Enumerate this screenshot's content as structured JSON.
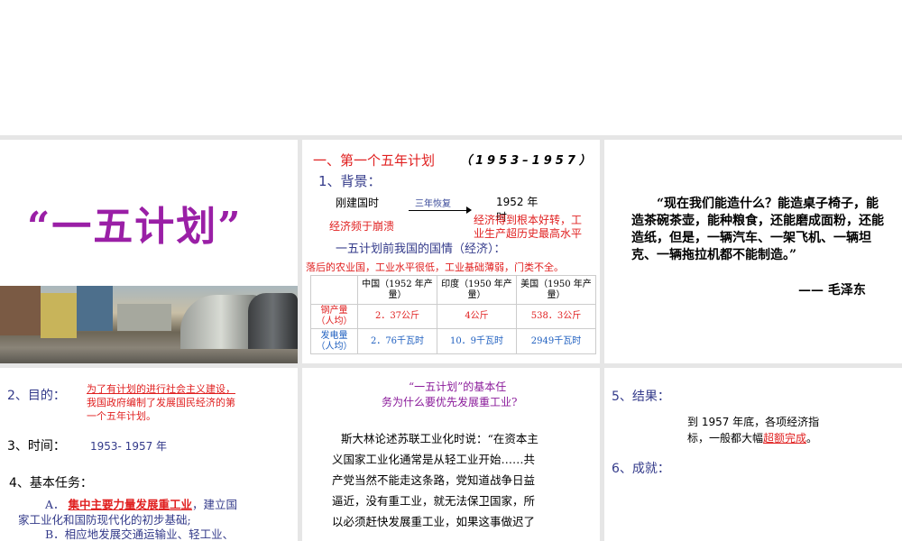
{
  "slide1": {
    "title": "“一五计划”"
  },
  "slide2": {
    "heading": "一、第一个五年计划",
    "years": "（1953–1957）",
    "bg": "1、背景：",
    "start": "刚建国时",
    "arrow": "三年恢复",
    "end": "1952 年时",
    "start_state": "经济频于崩溃",
    "end_state_1": "经济得到根本好转，工",
    "end_state_2": "业生产超历史最高水平",
    "situation": "一五计划前我国的国情（经济）：",
    "summary": "落后的农业国，工业水平很低，工业基础薄弱，门类不全。",
    "table": {
      "headers": [
        "",
        "中国（1952 年产量）",
        "印度（1950 年产量）",
        "美国（1950 年产量）"
      ],
      "rows": [
        [
          "钢产量（人均）",
          "2．37公斤",
          "4公斤",
          "538．3公斤"
        ],
        [
          "发电量（人均）",
          "2．76千瓦时",
          "10．9千瓦时",
          "2949千瓦时"
        ]
      ]
    }
  },
  "slide3": {
    "quote": "“现在我们能造什么？能造桌子椅子，能造茶碗茶壶，能种粮食，还能磨成面粉，还能造纸，但是，一辆汽车、一架飞机、一辆坦克、一辆拖拉机都不能制造。”",
    "author": "—— 毛泽东"
  },
  "slide4": {
    "purpose_label": "2、目的：",
    "purpose_1": "为了有计划的进行社会主义建设，",
    "purpose_2": "我国政府编制了发展国民经济的第",
    "purpose_3": "一个五年计划。",
    "time_label": "3、时间：",
    "time_value": "1953- 1957 年",
    "task_label": "4、基本任务：",
    "task_a_prefix": "A．",
    "task_a_key": "集中主要力量发展重工业",
    "task_a_rest": "，建立国",
    "task_a_2": "家工业化和国防现代化的初步基础;",
    "task_b": "B．相应地发展交通运输业、轻工业、"
  },
  "slide5": {
    "question_1": "“一五计划”的基本任",
    "question_2": "务为什么要优先发展重工业?",
    "lines": [
      "斯大林论述苏联工业化时说：“在资本主",
      "义国家工业化通常是从轻工业开始……共",
      "产党当然不能走这条路，党知道战争日益",
      "逼近，没有重工业，就无法保卫国家，所",
      "以必须赶快发展重工业，如果这事做迟了"
    ]
  },
  "slide6": {
    "result_label": "5、结果：",
    "result_1": "到 1957 年底，各项经济指",
    "result_2a": "标，一般都大幅",
    "result_2b": "超额完成",
    "result_2c": "。",
    "achieve_label": "6、成就："
  }
}
